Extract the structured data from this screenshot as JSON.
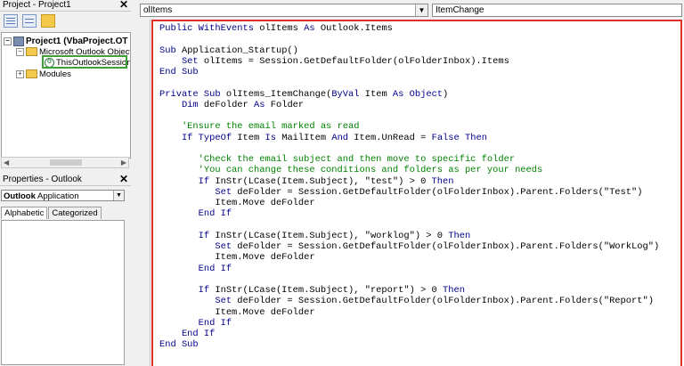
{
  "project_explorer": {
    "title": "Project - Project1",
    "close": "✕",
    "tree": {
      "project": "Project1 (VbaProject.OT",
      "outlook_objects": "Microsoft Outlook Object",
      "session": "ThisOutlookSession",
      "modules": "Modules"
    }
  },
  "properties": {
    "title": "Properties - Outlook",
    "close": "✕",
    "object_name": "Outlook",
    "object_type": "Application",
    "tabs": [
      "Alphabetic",
      "Categorized"
    ]
  },
  "code_window": {
    "object_combo": "olItems",
    "procedure_combo": "ItemChange",
    "lines": [
      [
        {
          "t": "kw",
          "v": "Public WithEvents "
        },
        {
          "t": "tx",
          "v": "olItems "
        },
        {
          "t": "kw",
          "v": "As "
        },
        {
          "t": "tx",
          "v": "Outlook.Items"
        }
      ],
      [],
      [
        {
          "t": "kw",
          "v": "Sub "
        },
        {
          "t": "tx",
          "v": "Application_Startup()"
        }
      ],
      [
        {
          "t": "kw",
          "v": "    Set "
        },
        {
          "t": "tx",
          "v": "olItems = Session.GetDefaultFolder(olFolderInbox).Items"
        }
      ],
      [
        {
          "t": "kw",
          "v": "End Sub"
        }
      ],
      [],
      [
        {
          "t": "kw",
          "v": "Private Sub "
        },
        {
          "t": "tx",
          "v": "olItems_ItemChange("
        },
        {
          "t": "kw",
          "v": "ByVal "
        },
        {
          "t": "tx",
          "v": "Item "
        },
        {
          "t": "kw",
          "v": "As Object"
        },
        {
          "t": "tx",
          "v": ")"
        }
      ],
      [
        {
          "t": "kw",
          "v": "    Dim "
        },
        {
          "t": "tx",
          "v": "deFolder "
        },
        {
          "t": "kw",
          "v": "As "
        },
        {
          "t": "tx",
          "v": "Folder"
        }
      ],
      [],
      [
        {
          "t": "cm",
          "v": "    'Ensure the email marked as read"
        }
      ],
      [
        {
          "t": "kw",
          "v": "    If TypeOf "
        },
        {
          "t": "tx",
          "v": "Item "
        },
        {
          "t": "kw",
          "v": "Is "
        },
        {
          "t": "tx",
          "v": "MailItem "
        },
        {
          "t": "kw",
          "v": "And "
        },
        {
          "t": "tx",
          "v": "Item.UnRead = "
        },
        {
          "t": "kw",
          "v": "False Then"
        }
      ],
      [],
      [
        {
          "t": "cm",
          "v": "       'Check the email subject and then move to specific folder"
        }
      ],
      [
        {
          "t": "cm",
          "v": "       'You can change these conditions and folders as per your needs"
        }
      ],
      [
        {
          "t": "kw",
          "v": "       If "
        },
        {
          "t": "tx",
          "v": "InStr(LCase(Item.Subject), \"test\") > 0 "
        },
        {
          "t": "kw",
          "v": "Then"
        }
      ],
      [
        {
          "t": "kw",
          "v": "          Set "
        },
        {
          "t": "tx",
          "v": "deFolder = Session.GetDefaultFolder(olFolderInbox).Parent.Folders(\"Test\")"
        }
      ],
      [
        {
          "t": "tx",
          "v": "          Item.Move deFolder"
        }
      ],
      [
        {
          "t": "kw",
          "v": "       End If"
        }
      ],
      [],
      [
        {
          "t": "kw",
          "v": "       If "
        },
        {
          "t": "tx",
          "v": "InStr(LCase(Item.Subject), \"worklog\") > 0 "
        },
        {
          "t": "kw",
          "v": "Then"
        }
      ],
      [
        {
          "t": "kw",
          "v": "          Set "
        },
        {
          "t": "tx",
          "v": "deFolder = Session.GetDefaultFolder(olFolderInbox).Parent.Folders(\"WorkLog\")"
        }
      ],
      [
        {
          "t": "tx",
          "v": "          Item.Move deFolder"
        }
      ],
      [
        {
          "t": "kw",
          "v": "       End If"
        }
      ],
      [],
      [
        {
          "t": "kw",
          "v": "       If "
        },
        {
          "t": "tx",
          "v": "InStr(LCase(Item.Subject), \"report\") > 0 "
        },
        {
          "t": "kw",
          "v": "Then"
        }
      ],
      [
        {
          "t": "kw",
          "v": "          Set "
        },
        {
          "t": "tx",
          "v": "deFolder = Session.GetDefaultFolder(olFolderInbox).Parent.Folders(\"Report\")"
        }
      ],
      [
        {
          "t": "tx",
          "v": "          Item.Move deFolder"
        }
      ],
      [
        {
          "t": "kw",
          "v": "       End If"
        }
      ],
      [
        {
          "t": "kw",
          "v": "    End If"
        }
      ],
      [
        {
          "t": "kw",
          "v": "End Sub"
        }
      ]
    ]
  },
  "colors": {
    "highlight_frame": "#e0302a",
    "session_highlight": "#3fa03a",
    "keyword": "#00008b",
    "comment": "#008000"
  }
}
